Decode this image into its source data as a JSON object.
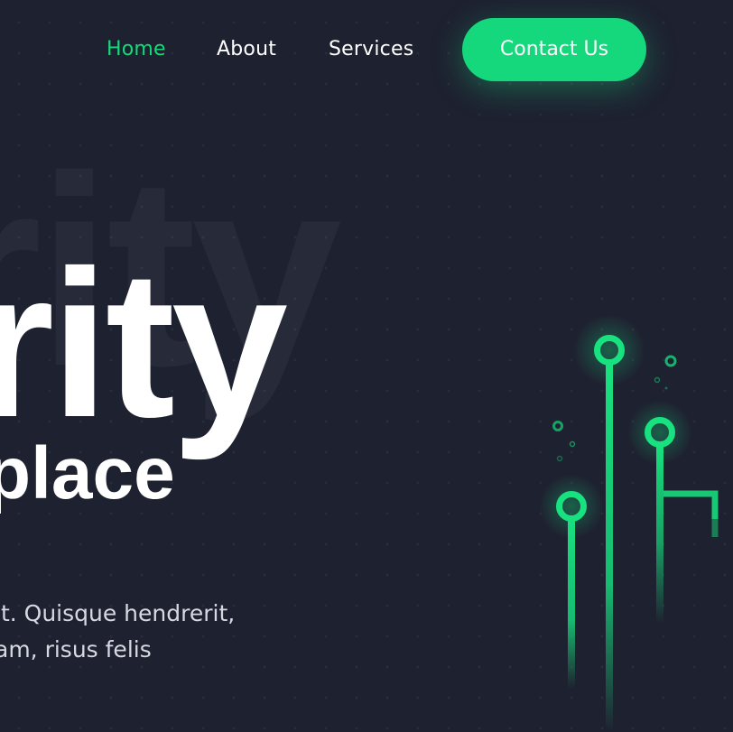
{
  "nav": {
    "items": [
      {
        "label": "Home",
        "active": true
      },
      {
        "label": "About",
        "active": false
      },
      {
        "label": "Services",
        "active": false
      }
    ],
    "cta_label": "Contact Us"
  },
  "hero": {
    "background_word": "rity",
    "title": "rity",
    "subtitle": "place",
    "paragraph_lines": [
      "it. Quisque hendrerit,",
      "am, risus felis",
      "."
    ]
  },
  "colors": {
    "background": "#1e2130",
    "accent": "#15d77c",
    "text": "#ffffff"
  },
  "icons": {
    "illustration": "circuit-lines-icon"
  }
}
